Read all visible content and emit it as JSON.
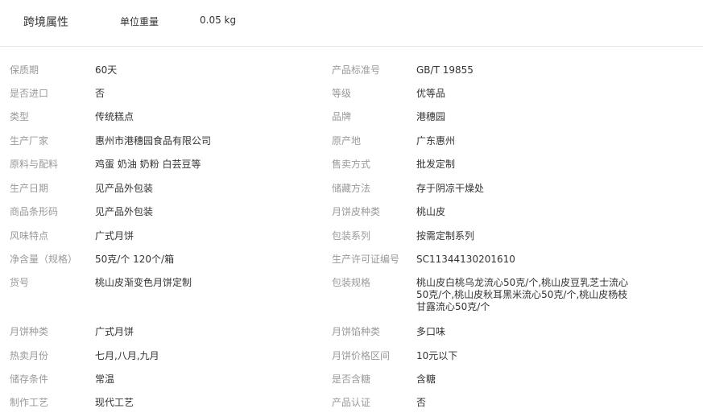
{
  "top": {
    "title": "跨境属性",
    "label": "单位重量",
    "value": "0.05 kg"
  },
  "attributes": [
    {
      "left": {
        "label": "保质期",
        "value": "60天"
      },
      "right": {
        "label": "产品标准号",
        "value": "GB/T 19855"
      }
    },
    {
      "left": {
        "label": "是否进口",
        "value": "否"
      },
      "right": {
        "label": "等级",
        "value": "优等品"
      }
    },
    {
      "left": {
        "label": "类型",
        "value": "传统糕点"
      },
      "right": {
        "label": "品牌",
        "value": "港穗园"
      }
    },
    {
      "left": {
        "label": "生产厂家",
        "value": "惠州市港穗园食品有限公司"
      },
      "right": {
        "label": "原产地",
        "value": "广东惠州"
      }
    },
    {
      "left": {
        "label": "原料与配料",
        "value": "鸡蛋 奶油 奶粉 白芸豆等"
      },
      "right": {
        "label": "售卖方式",
        "value": "批发定制"
      }
    },
    {
      "left": {
        "label": "生产日期",
        "value": "见产品外包装"
      },
      "right": {
        "label": "储藏方法",
        "value": "存于阴凉干燥处"
      }
    },
    {
      "left": {
        "label": "商品条形码",
        "value": "见产品外包装"
      },
      "right": {
        "label": "月饼皮种类",
        "value": "桃山皮"
      }
    },
    {
      "left": {
        "label": "风味特点",
        "value": "广式月饼"
      },
      "right": {
        "label": "包装系列",
        "value": "按需定制系列"
      }
    },
    {
      "left": {
        "label": "净含量（规格）",
        "value": "50克/个 120个/箱"
      },
      "right": {
        "label": "生产许可证编号",
        "value": "SC11344130201610"
      }
    },
    {
      "left": {
        "label": "货号",
        "value": "桃山皮渐变色月饼定制"
      },
      "right": {
        "label": "包装规格",
        "value": "桃山皮白桃乌龙流心50克/个,桃山皮豆乳芝士流心50克/个,桃山皮秋耳黑米流心50克/个,桃山皮杨枝甘露流心50克/个"
      }
    },
    {
      "left": {
        "label": "月饼种类",
        "value": "广式月饼"
      },
      "right": {
        "label": "月饼馅种类",
        "value": "多口味"
      }
    },
    {
      "left": {
        "label": "热卖月份",
        "value": "七月,八月,九月"
      },
      "right": {
        "label": "月饼价格区间",
        "value": "10元以下"
      }
    },
    {
      "left": {
        "label": "储存条件",
        "value": "常温"
      },
      "right": {
        "label": "是否含糖",
        "value": "含糖"
      }
    },
    {
      "left": {
        "label": "制作工艺",
        "value": "现代工艺"
      },
      "right": {
        "label": "产品认证",
        "value": "否"
      }
    }
  ]
}
